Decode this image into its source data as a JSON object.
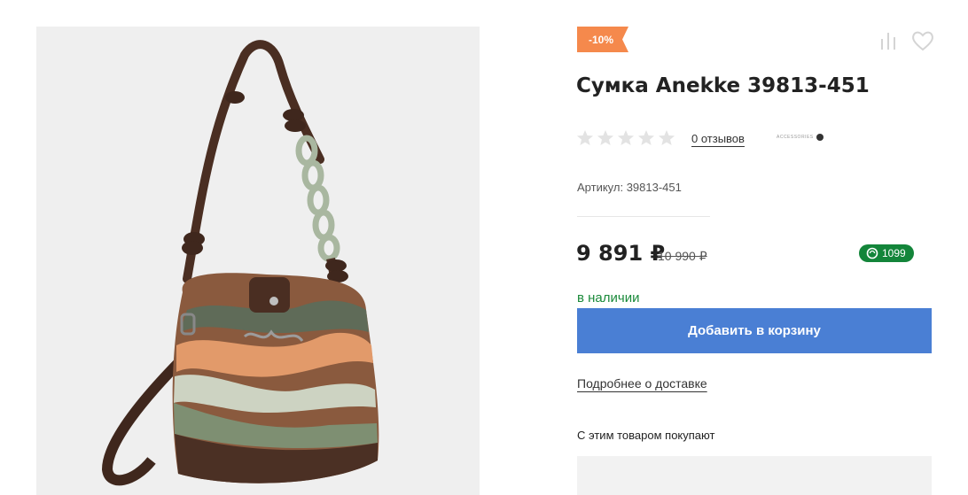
{
  "product": {
    "image_alt": "Anekke handbag",
    "discount_badge": "-10%",
    "title": "Сумка Anekke 39813-451",
    "rating": {
      "stars_total": 5,
      "stars_filled": 0
    },
    "reviews_link": "0 отзывов",
    "brand_logo_text": "ACCESSORIES",
    "sku": "Артикул: 39813-451",
    "price": "9 891 ₽",
    "old_price": "10 990 ₽",
    "bonus": "1099",
    "availability": "в наличии",
    "add_to_cart_label": "Добавить в корзину",
    "delivery_link": "Подробнее о доставке",
    "related_heading": "С этим товаром покупают"
  },
  "icons": {
    "compare": "compare-icon",
    "favorite": "heart-icon",
    "star": "star-icon",
    "bonus": "bonus-coin-icon"
  },
  "colors": {
    "discount_badge": "#f5894c",
    "cart_button": "#4a7fd4",
    "bonus_badge": "#13853a",
    "in_stock": "#1a8a3a",
    "stars": "#e3e3e3"
  }
}
